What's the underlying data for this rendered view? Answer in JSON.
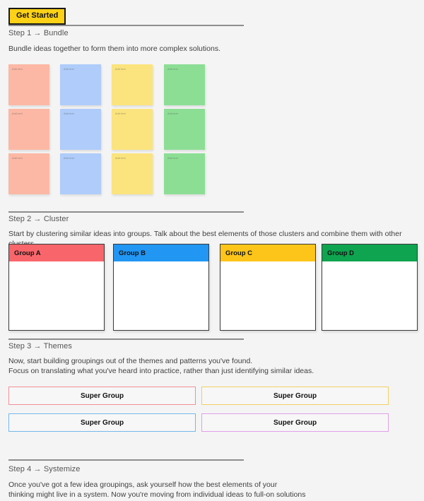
{
  "toolbar": {
    "get_started_label": "Get Started"
  },
  "colors": {
    "background": "#f4f4f4",
    "accent_yellow": "#fcd116",
    "divider": "#8d8d8d"
  },
  "steps": [
    {
      "label": "Step 1 → Bundle",
      "body": "Bundle ideas together to form them into more complex solutions."
    },
    {
      "label": "Step 2 → Cluster",
      "body": "Start by clustering similar ideas into groups. Talk about the best elements of those clusters and combine them with other clusters."
    },
    {
      "label": "Step 3 → Themes",
      "body": "Now, start building groupings out of the themes and patterns you've found.\nFocus on translating what you've heard into practice, rather than just identifying similar ideas."
    },
    {
      "label": "Step 4 → Systemize",
      "body": "Once you've got a few idea groupings, ask yourself how the best elements of your\nthinking might live in a system. Now you're moving from individual ideas to full-on solutions"
    }
  ],
  "sticky_notes": {
    "placeholder": "Add text",
    "columns": [
      {
        "color": "#fcb8a4"
      },
      {
        "color": "#afccfa"
      },
      {
        "color": "#fbe47d"
      },
      {
        "color": "#8cde95"
      }
    ],
    "rows": 3
  },
  "groups": [
    {
      "title": "Group A",
      "header_color": "#f8666b"
    },
    {
      "title": "Group B",
      "header_color": "#2196f3"
    },
    {
      "title": "Group C",
      "header_color": "#fdc51a"
    },
    {
      "title": "Group D",
      "header_color": "#0fa44f"
    }
  ],
  "super_groups": [
    {
      "title": "Super Group",
      "border_color": "#f09098"
    },
    {
      "title": "Super Group",
      "border_color": "#f3cf63"
    },
    {
      "title": "Super Group",
      "border_color": "#74b9ea"
    },
    {
      "title": "Super Group",
      "border_color": "#e0a0e8"
    }
  ]
}
